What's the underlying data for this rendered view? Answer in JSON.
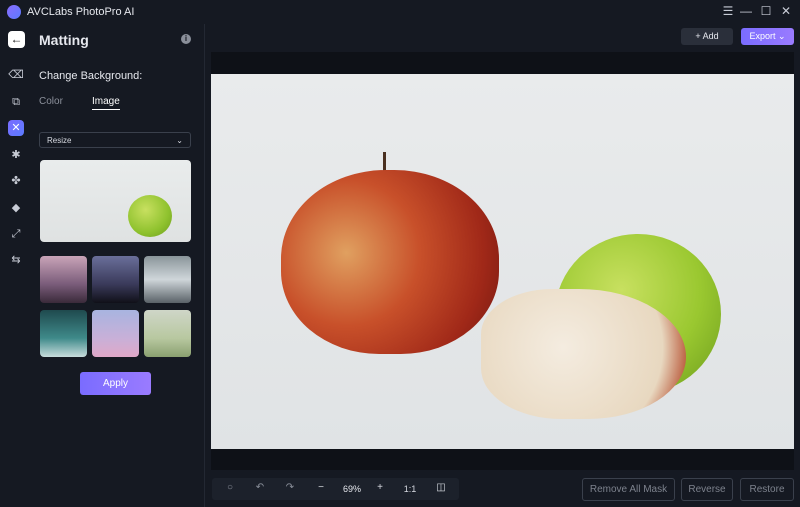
{
  "app": {
    "title": "AVCLabs PhotoPro AI"
  },
  "window": {
    "menu_icon": "☰",
    "minimize_icon": "—",
    "maximize_icon": "☐",
    "close_icon": "✕"
  },
  "panel": {
    "title": "Matting",
    "back_icon": "←",
    "info_icon": "i",
    "change_background_label": "Change Background:",
    "tabs": [
      {
        "label": "Color",
        "active": false
      },
      {
        "label": "Image",
        "active": true
      }
    ],
    "resize_select": {
      "value": "Resize"
    },
    "apply_label": "Apply"
  },
  "rail": {
    "items": [
      "eraser",
      "face-swap",
      "matting",
      "object-remove",
      "enhance",
      "colorize",
      "upscale",
      "adjust"
    ]
  },
  "header": {
    "add_label": "+ Add",
    "export_label": "Export"
  },
  "toolbar": {
    "zoom": "69%",
    "one_to_one": "1:1",
    "minus": "−",
    "plus": "+"
  },
  "actions": {
    "remove_all_mask": "Remove All Mask",
    "reverse": "Reverse",
    "restore": "Restore"
  },
  "colors": {
    "accent": "#8a6cff",
    "background": "#151922"
  }
}
